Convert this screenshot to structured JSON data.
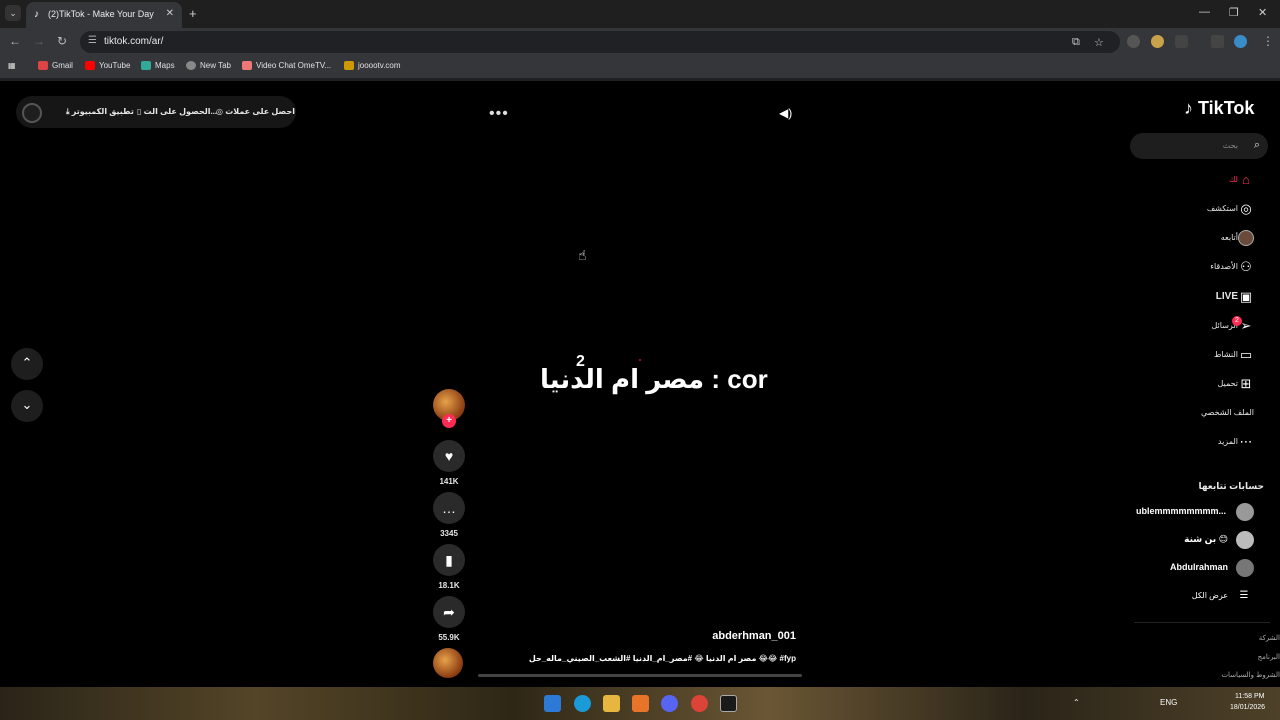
{
  "browser": {
    "tab_title": "(2)TikTok - Make Your Day",
    "url": "tiktok.com/ar/",
    "bookmarks": [
      "Gmail",
      "YouTube",
      "Maps",
      "New Tab",
      "Video Chat OmeTV...",
      "jooootv.com"
    ]
  },
  "topbar": {
    "get_coins": "احصل على عملات",
    "get_app": "الحصول على الت...",
    "pc_app": "تطبيق الكمبيوتر"
  },
  "video": {
    "overlay_text": "مصر ام الدنيا : cor",
    "superscript": "2",
    "likes": "141K",
    "comments": "3345",
    "saves": "18.1K",
    "shares": "55.9K",
    "username": "abderhman_001",
    "caption": "مصر ام الدنيا 😂 #مصر_ام_الدنيا #الشعب_الصيني_ماله_حل 😂😂 #fyp"
  },
  "sidebar": {
    "logo": "TikTok",
    "search_placeholder": "بحث",
    "items": [
      {
        "label": "لك",
        "icon": "home-icon"
      },
      {
        "label": "استكشف",
        "icon": "compass-icon"
      },
      {
        "label": "أتابعه",
        "icon": "avatar-icon"
      },
      {
        "label": "الأصدقاء",
        "icon": "friends-icon"
      },
      {
        "label": "LIVE",
        "icon": "live-icon"
      },
      {
        "label": "الرسائل",
        "icon": "send-icon",
        "badge": "2"
      },
      {
        "label": "النشاط",
        "icon": "message-icon"
      },
      {
        "label": "تحميل",
        "icon": "upload-icon"
      },
      {
        "label": "الملف الشخصي",
        "icon": "profile-icon"
      },
      {
        "label": "المزيد",
        "icon": "more-icon"
      }
    ],
    "following_heading": "حسابات تتابعها",
    "accounts": [
      "ublemmmmmmmm...",
      "بن شنة 😊",
      "Abdulrahman"
    ],
    "see_all": "عرض الكل",
    "footer": [
      "الشركة",
      "البرنامج",
      "الشروط والسياسات"
    ]
  },
  "system": {
    "lang": "ENG",
    "time": "11:58 PM",
    "date": "18/01/2026"
  }
}
